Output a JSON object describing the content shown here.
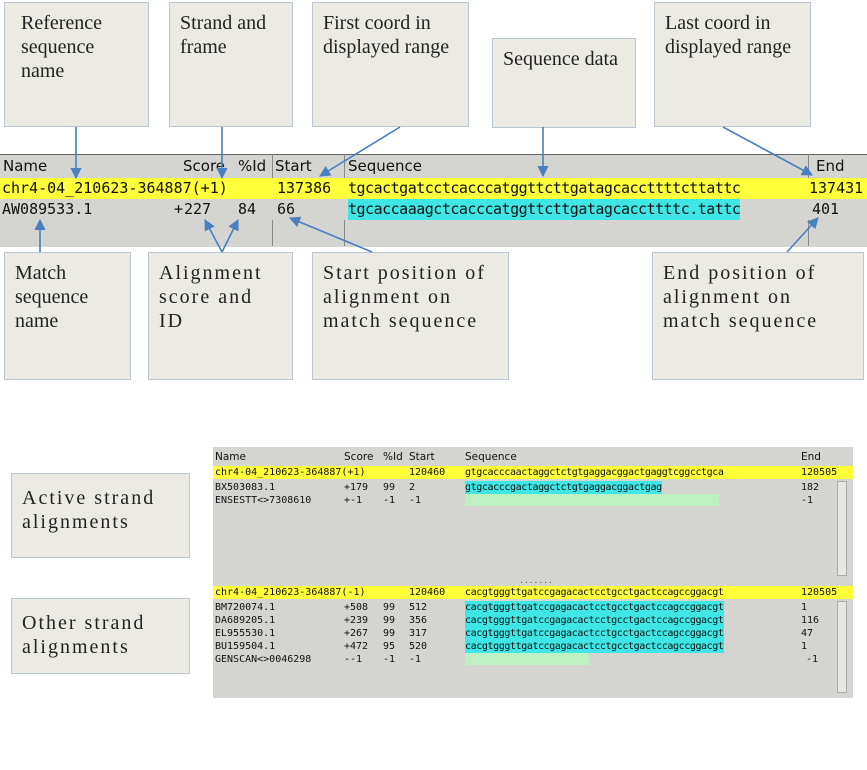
{
  "callouts": {
    "ref_name": "Reference sequence name",
    "strand_frame": "Strand and frame",
    "first_coord": "First coord in displayed range",
    "seq_data": "Sequence data",
    "last_coord": "Last coord in displayed range",
    "match_name": "Match sequence name",
    "align_score": "Alignment score and ID",
    "start_pos": "Start position of alignment on match sequence",
    "end_pos": "End position of alignment on match sequence",
    "active_strand": "Active strand alignments",
    "other_strand": "Other strand alignments"
  },
  "top_panel": {
    "headers": {
      "name": "Name",
      "score": "Score",
      "pctid": "%Id",
      "start": "Start",
      "sequence": "Sequence",
      "end": "End"
    },
    "ref_row": {
      "name": "chr4-04_210623-364887(+1)",
      "start": "137386",
      "sequence": "tgcactgatcctcacccatggttcttgatagcaccttttcttattc",
      "end": "137431"
    },
    "match_row": {
      "name": "AW089533.1",
      "strand": "+",
      "score": "227",
      "pctid": "84",
      "start": "66",
      "sequence": "tgcaccaaagctcacccatggttcttgatagcaccttttc.tattc",
      "end": "401"
    }
  },
  "bottom_panel": {
    "headers": {
      "name": "Name",
      "score": "Score",
      "pctid": "%Id",
      "start": "Start",
      "sequence": "Sequence",
      "end": "End"
    },
    "active_ref": {
      "name": "chr4-04_210623-364887(+1)",
      "start": "120460",
      "sequence": "gtgcacccaactaggctctgtgaggacggactgaggtcggcctgca",
      "end": "120505"
    },
    "active_rows": [
      {
        "name": "BX503083.1",
        "strand": "+",
        "score": "179",
        "pctid": "99",
        "start": "2",
        "sequence": "gtgcacccgactaggctctgtgaggacggactgag",
        "end": "182"
      },
      {
        "name": "ENSESTT<>7308610",
        "strand": "+",
        "score": "-1",
        "pctid": "-1",
        "start": "-1",
        "sequence": "",
        "end": "-1"
      }
    ],
    "other_ref": {
      "name": "chr4-04_210623-364887(-1)",
      "start": "120460",
      "sequence": "cacgtgggttgatccgagacactcctgcctgactccagccggacgt",
      "end": "120505"
    },
    "other_rows": [
      {
        "name": "BM720074.1",
        "strand": "+",
        "score": "508",
        "pctid": "99",
        "start": "512",
        "sequence": "cacgtgggttgatccgagacactcctgcctgactccagccggacgt",
        "end": "1"
      },
      {
        "name": "DA689205.1",
        "strand": "+",
        "score": "239",
        "pctid": "99",
        "start": "356",
        "sequence": "cacgtgggttgatccgagacactcctgcctgactccagccggacgt",
        "end": "116"
      },
      {
        "name": "EL955530.1",
        "strand": "+",
        "score": "267",
        "pctid": "99",
        "start": "317",
        "sequence": "cacgtgggttgatccgagacactcctgcctgactccagccggacgt",
        "end": "47"
      },
      {
        "name": "BU159504.1",
        "strand": "+",
        "score": "472",
        "pctid": "95",
        "start": "520",
        "sequence": "cacgtgggttgatccgagacactcctgcctgactccagccggacgt",
        "end": "1"
      },
      {
        "name": "GENSCAN<>0046298",
        "strand": "-",
        "score": "-1",
        "pctid": "-1",
        "start": "-1",
        "sequence": "",
        "end": "-1"
      }
    ],
    "dots": "......."
  },
  "colors": {
    "ref_highlight": "#ffff3a",
    "match_highlight": "#3ee6e6",
    "gap_highlight": "#bff0c2",
    "arrow": "#4a7fc0"
  }
}
